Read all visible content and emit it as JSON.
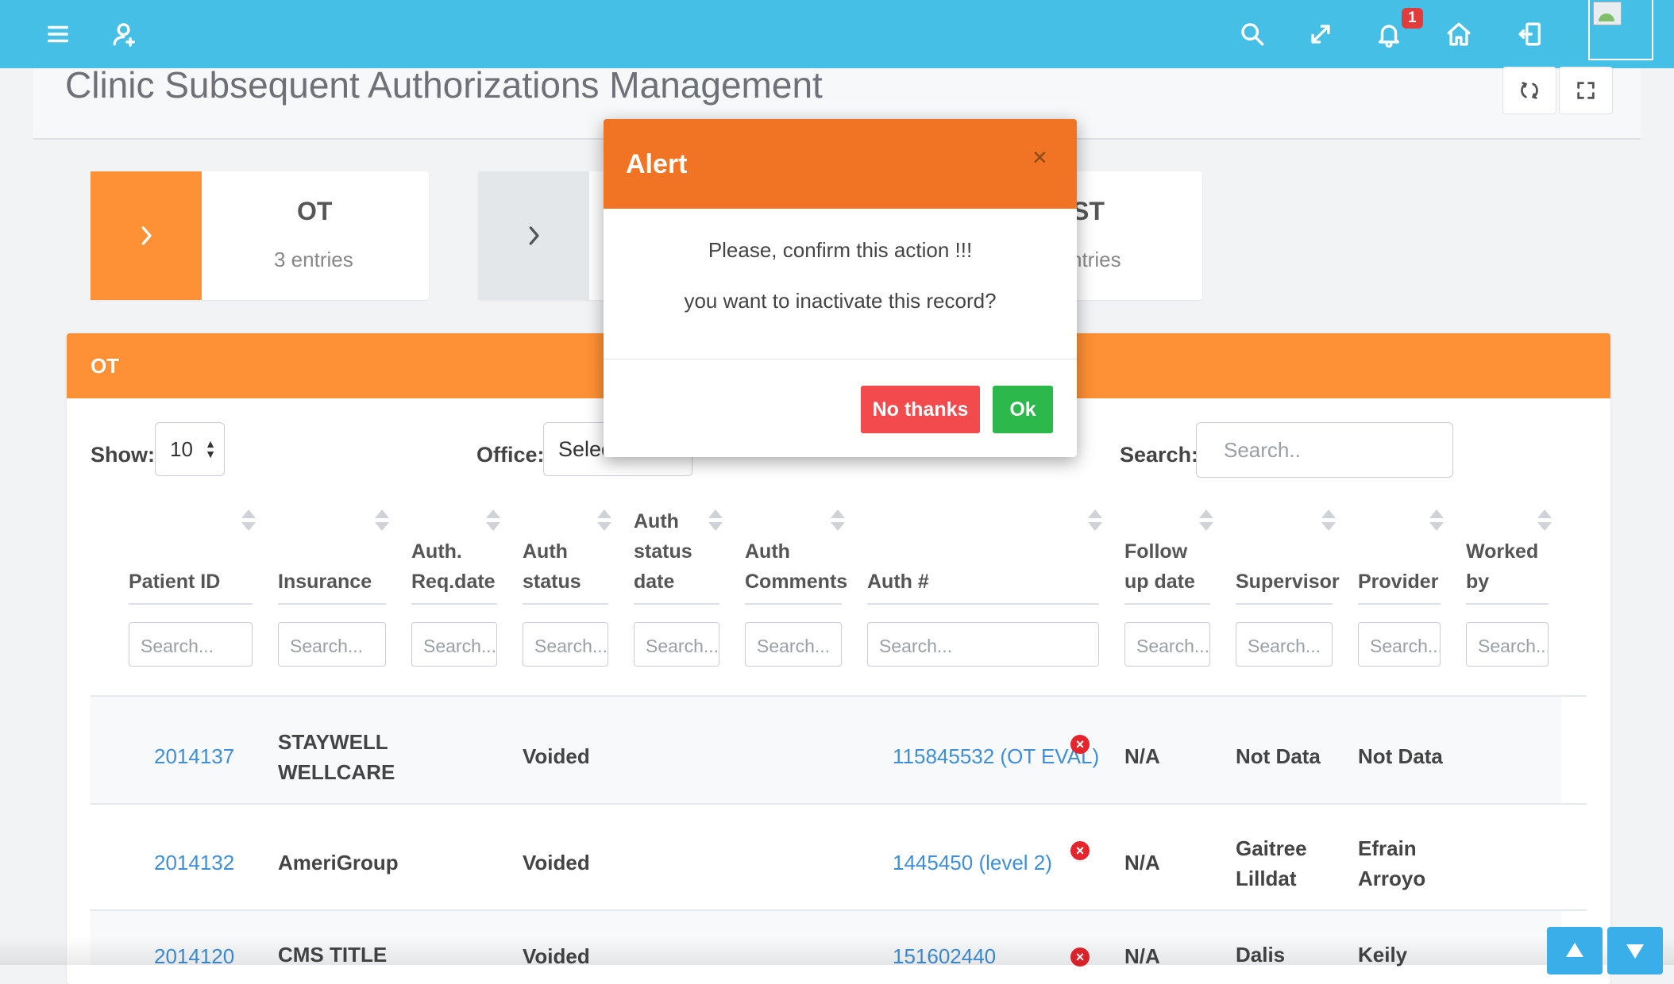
{
  "topbar": {
    "notification_count": "1",
    "icons": [
      "menu-icon",
      "user-add-icon",
      "search-icon",
      "expand-icon",
      "bell-icon",
      "home-icon",
      "logout-icon"
    ]
  },
  "page": {
    "title": "Clinic Subsequent Authorizations Management"
  },
  "cards": [
    {
      "title": "OT",
      "subtitle": "3 entries"
    },
    {
      "title": "ST",
      "subtitle": "ntries"
    }
  ],
  "panel": {
    "title": "OT",
    "show_label": "Show:",
    "show_value": "10",
    "office_label": "Office:",
    "office_value": "Selec",
    "search_label": "Search:",
    "search_placeholder": "Search.."
  },
  "table": {
    "columns": [
      {
        "label": "Patient ID",
        "search": "Search..."
      },
      {
        "label": "Insurance",
        "search": "Search..."
      },
      {
        "label": "Auth. Req.date",
        "search": "Search..."
      },
      {
        "label": "Auth status",
        "search": "Search..."
      },
      {
        "label": "Auth status date",
        "search": "Search..."
      },
      {
        "label": "Auth Comments",
        "search": "Search..."
      },
      {
        "label": "Auth #",
        "search": "Search..."
      },
      {
        "label": "Follow up date",
        "search": "Search..."
      },
      {
        "label": "Supervisor",
        "search": "Search..."
      },
      {
        "label": "Provider",
        "search": "Search..."
      },
      {
        "label": "Worked by",
        "search": "Search..."
      }
    ],
    "rows": [
      {
        "patient_id": "2014137",
        "insurance": "STAYWELL WELLCARE",
        "auth_status": "Voided",
        "auth_no": "115845532 (OT EVAL)",
        "follow_up": "N/A",
        "supervisor": "Not Data",
        "provider": "Not Data"
      },
      {
        "patient_id": "2014132",
        "insurance": "AmeriGroup",
        "auth_status": "Voided",
        "auth_no": "1445450 (level 2)",
        "follow_up": "N/A",
        "supervisor": "Gaitree Lilldat",
        "provider": "Efrain Arroyo"
      },
      {
        "patient_id": "2014120",
        "insurance": "CMS TITLE",
        "auth_status": "Voided",
        "auth_no": "151602440",
        "follow_up": "N/A",
        "supervisor": "Dalis",
        "provider": "Keily"
      }
    ]
  },
  "modal": {
    "title": "Alert",
    "close_symbol": "×",
    "message_line1": "Please, confirm this action !!!",
    "message_line2": "you want to inactivate this record?",
    "no_label": "No thanks",
    "ok_label": "Ok"
  },
  "colors": {
    "topbar": "#45bfe6",
    "accent_orange": "#fe9035",
    "modal_header": "#f07423",
    "danger": "#f24a4d",
    "success": "#2cb84a",
    "link": "#3e8fd8"
  }
}
